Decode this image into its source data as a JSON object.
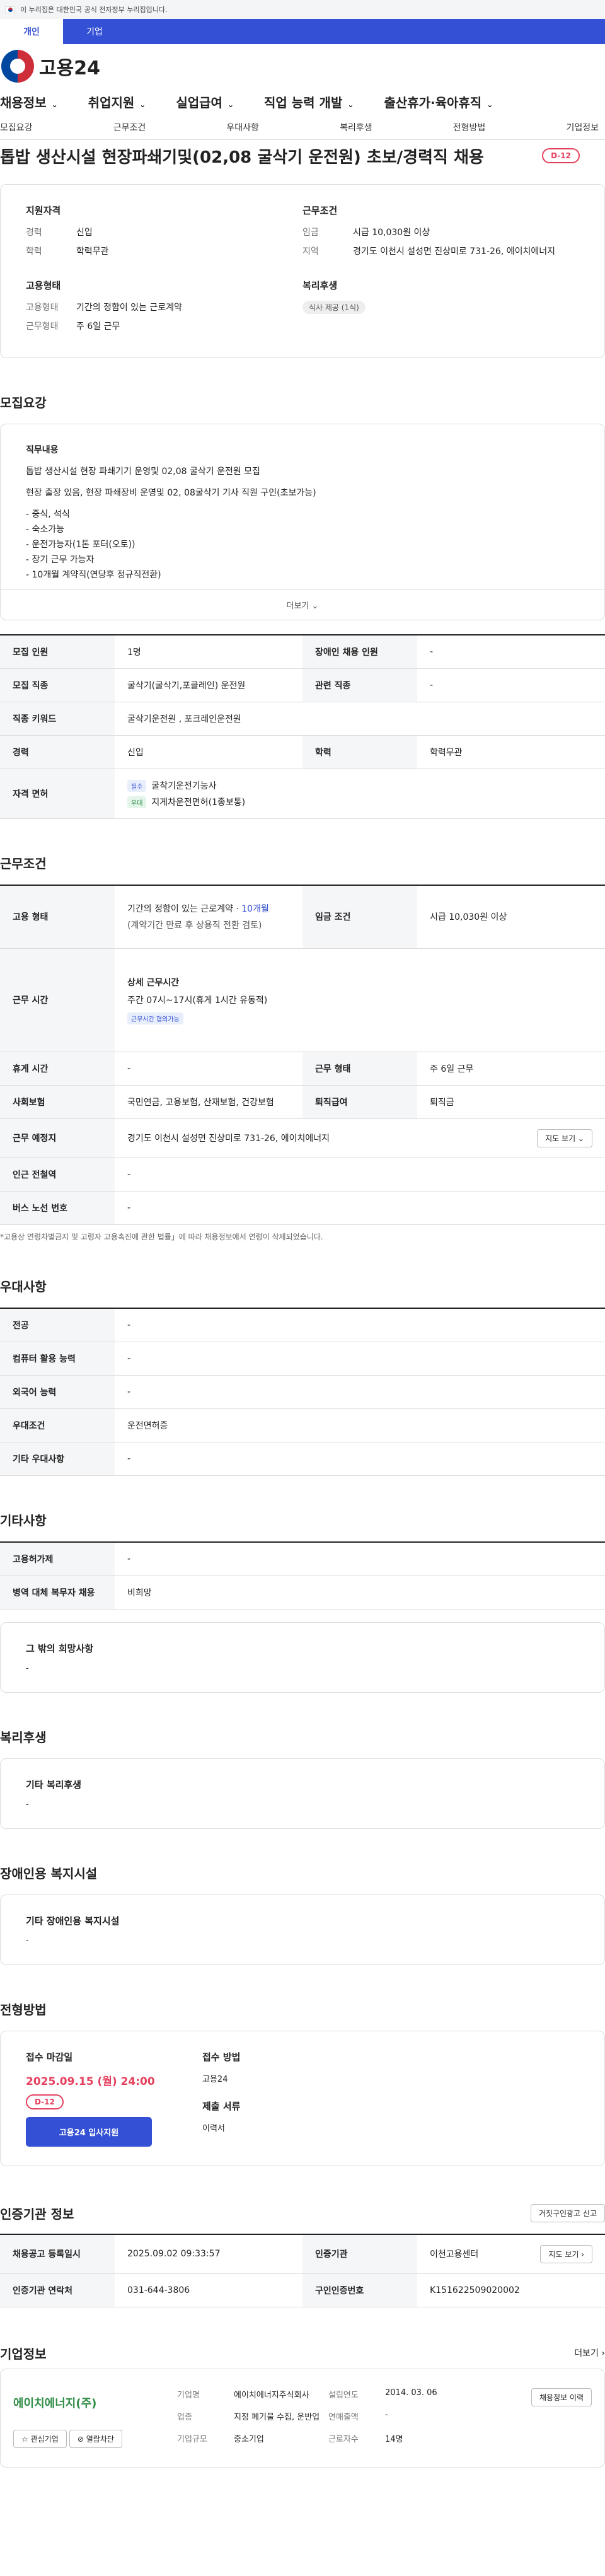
{
  "gov": "이 누리집은 대한민국 공식 전자정부 누리집입니다.",
  "top_tabs": [
    "개인",
    "기업"
  ],
  "brand": "고용24",
  "gnb": [
    "채용정보",
    "취업지원",
    "실업급여",
    "직업 능력 개발",
    "출산휴가·육아휴직"
  ],
  "snb": [
    "모집요강",
    "근무조건",
    "우대사항",
    "복리후생",
    "전형방법",
    "기업정보"
  ],
  "job_title": "톱밥 생산시설 현장파쇄기및(02,08 굴삭기 운전원) 초보/경력직 채용",
  "dday": "D-12",
  "summary": {
    "q_title": "지원자격",
    "q_rows": [
      [
        "경력",
        "신입"
      ],
      [
        "학력",
        "학력무관"
      ]
    ],
    "c_title": "근무조건",
    "c_rows": [
      [
        "임금",
        "시급 10,030원 이상"
      ],
      [
        "지역",
        "경기도 이천시 설성면 진상미로 731-26, 에이치에너지"
      ]
    ],
    "e_title": "고용형태",
    "e_rows": [
      [
        "고용형태",
        "기간의 정함이 있는 근로계약"
      ],
      [
        "근무형태",
        "주 6일 근무"
      ]
    ],
    "w_title": "복리후생",
    "w_chip": "식사 제공 (1식)"
  },
  "recruit": {
    "title": "모집요강",
    "duty_label": "직무내용",
    "duty": [
      "톱밥 생산시설 현장 파쇄기기 운영및 02,08 굴삭기 운전원 모집",
      "현장 출장 있음, 현장 파쇄장비 운영및 02, 08굴삭기 기사 직원 구인(초보가능)",
      "- 중식, 석식",
      "- 숙소가능",
      "- 운전가능자(1톤 포터(오토))",
      "- 장기 근무 가능자",
      "- 10개월 계약직(연당후 정규직전환)"
    ],
    "more": "더보기 ⌄",
    "rows": [
      [
        "모집 인원",
        "1명",
        "장애인 채용 인원",
        "-"
      ],
      [
        "모집 직종",
        "굴삭기(굴삭기,포클레인) 운전원",
        "관련 직종",
        "-"
      ],
      [
        "직종 키워드",
        "굴삭기운전원 , 포크레인운전원"
      ],
      [
        "경력",
        "신입",
        "학력",
        "학력무관"
      ],
      [
        "자격 면허"
      ]
    ],
    "license": [
      [
        "필수",
        "굴착기운전기능사"
      ],
      [
        "우대",
        "지게차운전면허(1종보통)"
      ]
    ]
  },
  "cond": {
    "title": "근무조건",
    "emp_label": "고용 형태",
    "emp_a": "기간의 정함이 있는 근로계약 · ",
    "emp_b": "10개월",
    "emp_c": "(계약기간 만료 후 상용직 전환 검토)",
    "wage_label": "임금 조건",
    "wage": "시급 10,030원 이상",
    "hours_label": "근무 시간",
    "detail": "상세 근무시간",
    "detail_v": "주간 07시~17시(휴게 1시간 유동적)",
    "flex": "근무시간 협의가능",
    "rows": [
      [
        "휴게 시간",
        "-",
        "근무 형태",
        "주 6일 근무"
      ],
      [
        "사회보험",
        "국민연금, 고용보험, 산재보험, 건강보험",
        "퇴직급여",
        "퇴직금"
      ]
    ],
    "place_label": "근무 예정지",
    "place": "경기도 이천시 설성면 진상미로 731-26, 에이치에너지",
    "map": "지도 보기 ⌄",
    "r1": [
      "인근 전철역",
      "-"
    ],
    "r2": [
      "버스 노선 번호",
      "-"
    ],
    "note": "*고용상 연령차별금지 및 고령자 고용촉진에 관한 법률」에 따라 채용정보에서 연령이 삭제되었습니다."
  },
  "pref": {
    "title": "우대사항",
    "rows": [
      [
        "전공",
        "-"
      ],
      [
        "컴퓨터 활용 능력",
        "-"
      ],
      [
        "외국어 능력",
        "-"
      ],
      [
        "우대조건",
        "운전면허증"
      ],
      [
        "기타 우대사항",
        "-"
      ]
    ]
  },
  "etc": {
    "title": "기타사항",
    "rows": [
      [
        "고용허가제",
        "-"
      ],
      [
        "병역 대체 복무자 채용",
        "비희망"
      ]
    ],
    "hope": "그 밖의 희망사항",
    "hope_v": "-"
  },
  "welfare": {
    "title": "복리후생",
    "t": "기타 복리후생",
    "v": "-"
  },
  "disab": {
    "title": "장애인용 복지시설",
    "t": "기타 장애인용 복지시설",
    "v": "-"
  },
  "selection": {
    "title": "전형방법",
    "deadline_l": "접수 마감일",
    "deadline": "2025.09.15 (월) 24:00",
    "dday": "D-12",
    "apply": "고용24 입사지원",
    "method_l": "접수 방법",
    "method": "고용24",
    "docs_l": "제출 서류",
    "docs": "이력서"
  },
  "cert": {
    "title": "인증기관 정보",
    "report": "거짓구인광고 신고",
    "rows": [
      [
        "채용공고 등록일시",
        "2025.09.02 09:33:57",
        "인증기관",
        "이천고용센터"
      ],
      [
        "인증기관 연락처",
        "031-644-3806",
        "구인인증번호",
        "K151622509020002"
      ]
    ],
    "map": "지도 보기 ›"
  },
  "company": {
    "title": "기업정보",
    "more": "더보기 ›",
    "logo_text": "에이치에너지(주)",
    "fav": "☆ 관심기업",
    "block": "⊘ 열람차단",
    "hist": "채용정보 이력",
    "rows": [
      [
        "기업명",
        "에이치에너지주식회사",
        "설립연도",
        "2014. 03. 06"
      ],
      [
        "업종",
        "지정 폐기물 수집, 운반업",
        "연매출액",
        "-"
      ],
      [
        "기업규모",
        "중소기업",
        "근로자수",
        "14명"
      ]
    ]
  }
}
